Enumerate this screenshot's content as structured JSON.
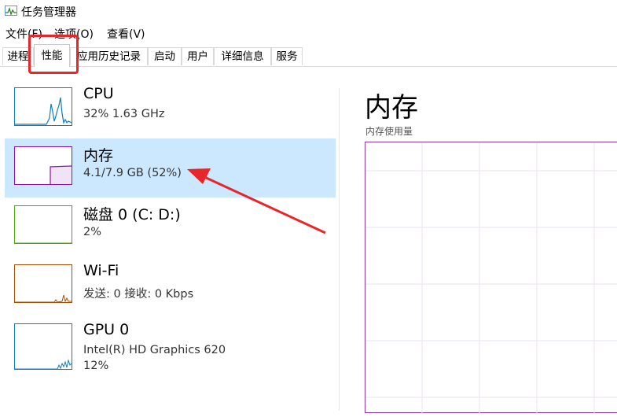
{
  "window": {
    "title": "任务管理器"
  },
  "menu": [
    "文件(F)",
    "选项(O)",
    "查看(V)"
  ],
  "tabs": [
    "进程",
    "性能",
    "应用历史记录",
    "启动",
    "用户",
    "详细信息",
    "服务"
  ],
  "active_tab": "性能",
  "perf_items": [
    {
      "name": "CPU",
      "line1": "32%  1.63 GHz",
      "line2": "",
      "color": "#117dbb",
      "selected": false
    },
    {
      "name": "内存",
      "line1": "4.1/7.9 GB (52%)",
      "line2": "",
      "color": "#8b12ae",
      "selected": true
    },
    {
      "name": "磁盘 0 (C: D:)",
      "line1": "2%",
      "line2": "",
      "color": "#4da60c",
      "selected": false
    },
    {
      "name": "Wi-Fi",
      "line1": "发送: 0 接收: 0 Kbps",
      "line2": "",
      "color": "#a74f01",
      "selected": false
    },
    {
      "name": "GPU 0",
      "line1": "Intel(R) HD Graphics 620",
      "line2": "12%",
      "color": "#117dbb",
      "selected": false
    }
  ],
  "detail": {
    "title": "内存",
    "graph_label": "内存使用量"
  },
  "colors": {
    "annotation": "#e8262a",
    "selection": "#cce8ff",
    "memory_graph": "#8b3aa5"
  }
}
